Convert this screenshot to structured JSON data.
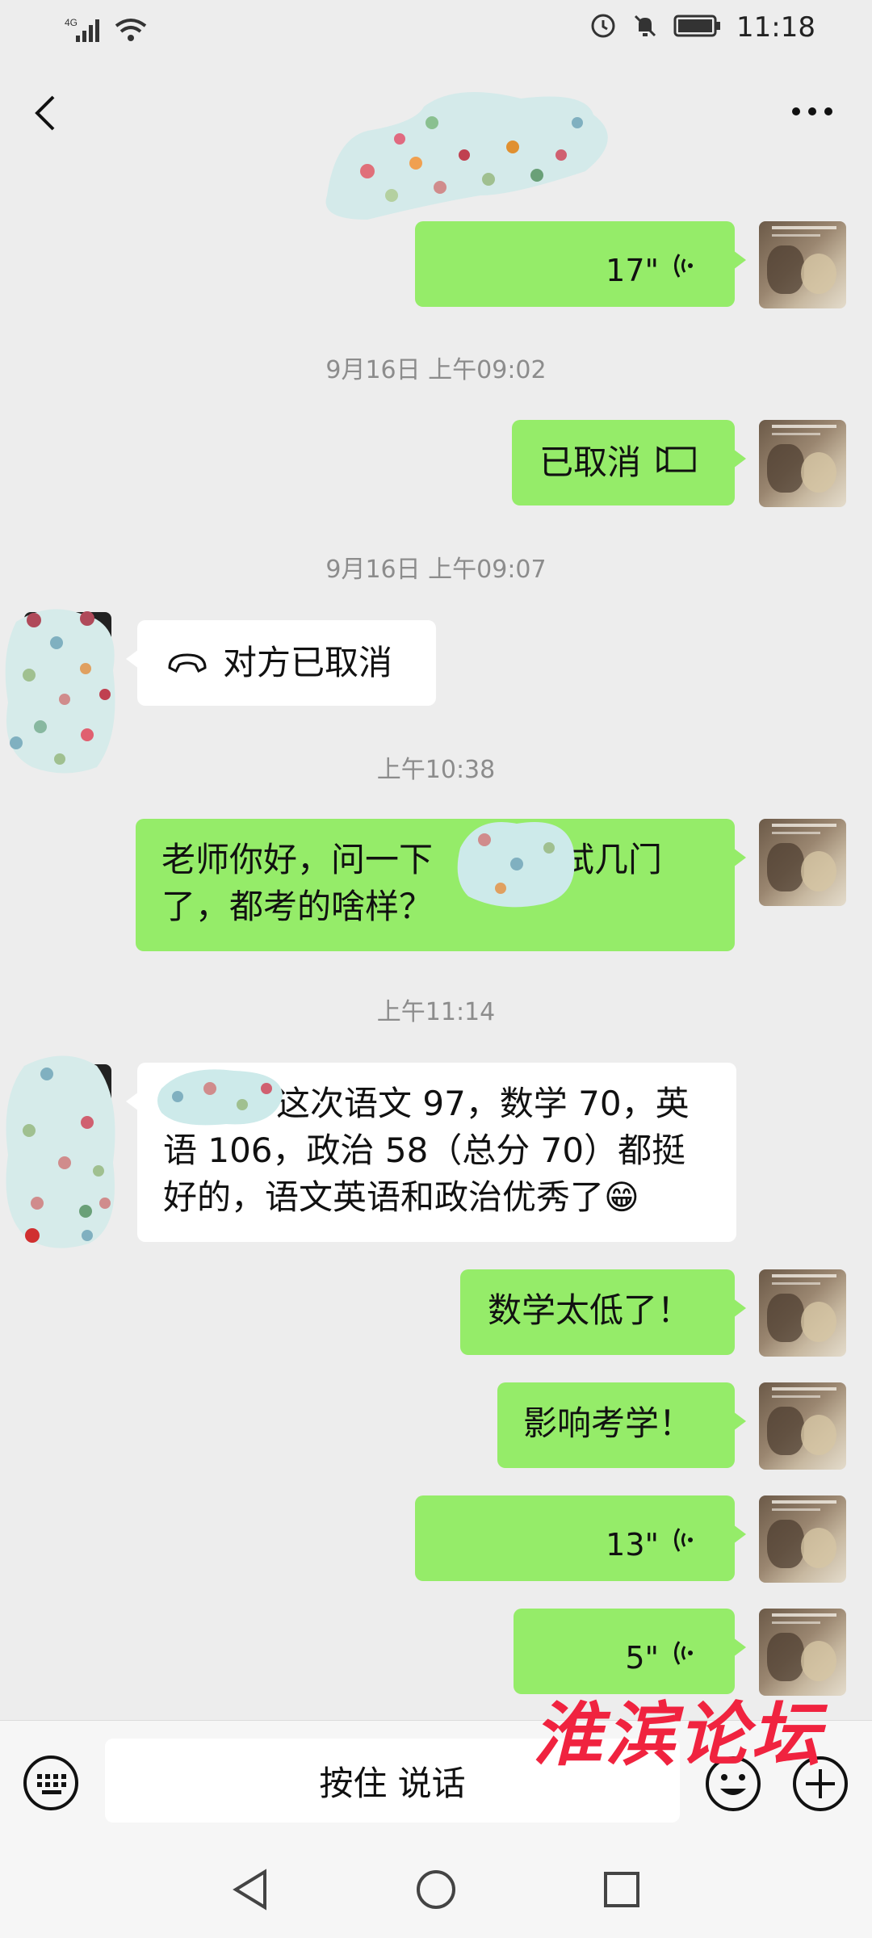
{
  "status_bar": {
    "network": "4G",
    "time": "11:18"
  },
  "messages": [
    {
      "id": "voice-1",
      "type": "voice",
      "duration": "17\""
    },
    {
      "type": "timestamp",
      "text": "9月16日 上午09:02"
    },
    {
      "id": "call-out",
      "type": "call",
      "text": "已取消"
    },
    {
      "type": "timestamp",
      "text": "9月16日 上午09:07"
    },
    {
      "id": "call-in",
      "type": "call",
      "text": "对方已取消"
    },
    {
      "type": "timestamp",
      "text": "上午10:38"
    },
    {
      "id": "text-1",
      "type": "text",
      "lines": [
        "老师你好，问一下",
        "考试几门",
        "了，都考的啥样？"
      ]
    },
    {
      "type": "timestamp",
      "text": "上午11:14"
    },
    {
      "id": "text-2",
      "type": "text",
      "lines": [
        "这次语文 97，数学 70，英",
        "语 106，政治 58（总分 70）都挺",
        "好的，语文英语和政治优秀了😁"
      ]
    },
    {
      "id": "text-3",
      "type": "text",
      "text": "数学太低了！"
    },
    {
      "id": "text-4",
      "type": "text",
      "text": "影响考学！"
    },
    {
      "id": "voice-2",
      "type": "voice",
      "duration": "13\""
    },
    {
      "id": "voice-3",
      "type": "voice",
      "duration": "5\""
    }
  ],
  "input_bar": {
    "hold_to_talk": "按住 说话"
  },
  "watermark": "淮滨论坛",
  "colors": {
    "outgoing_bubble": "#95ec69",
    "incoming_bubble": "#ffffff",
    "background": "#ededed",
    "watermark": "#f0233f"
  },
  "icons": [
    "back-icon",
    "more-icon",
    "voice-wave-icon",
    "video-call-icon",
    "hangup-icon",
    "keyboard-icon",
    "emoji-icon",
    "plus-icon",
    "nav-back-icon",
    "nav-home-icon",
    "nav-recents-icon"
  ]
}
